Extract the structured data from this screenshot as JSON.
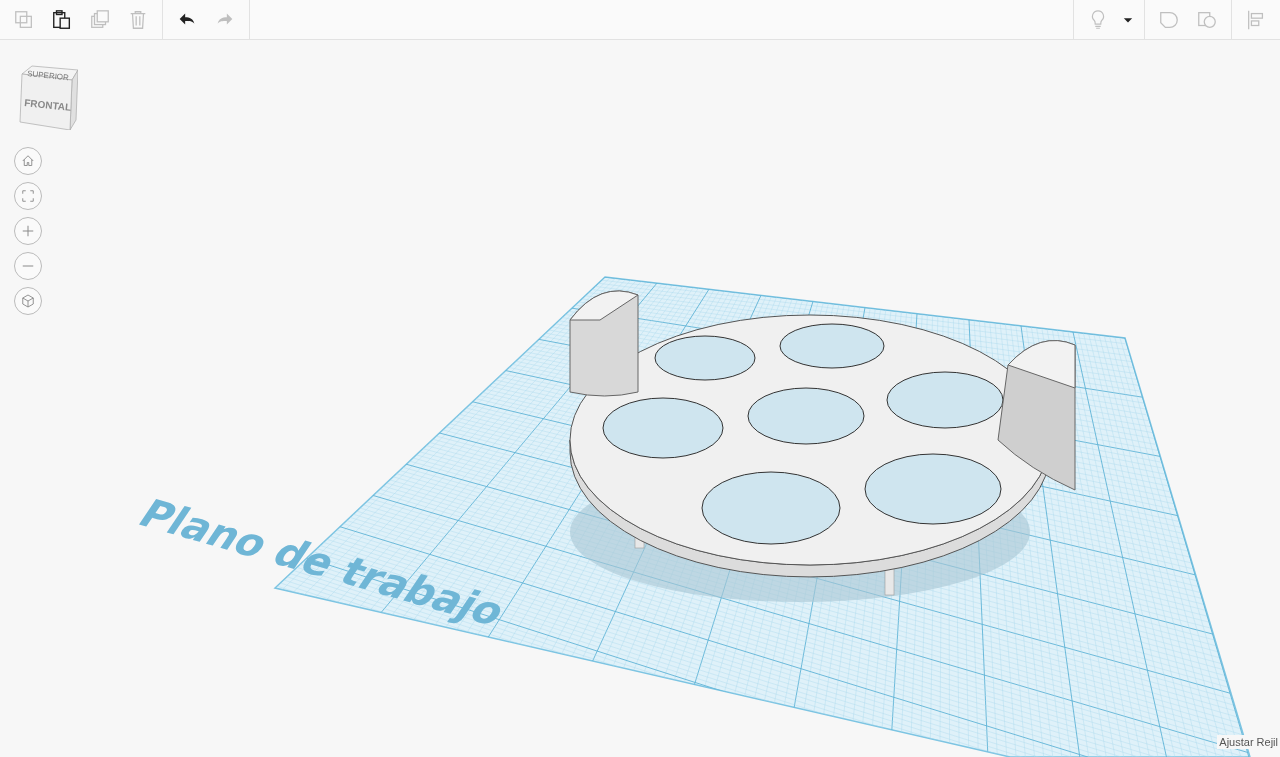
{
  "toolbar": {
    "edit_tools": [
      {
        "kind": "copy",
        "disabled": true
      },
      {
        "kind": "paste",
        "disabled": false
      },
      {
        "kind": "duplicate",
        "disabled": true
      },
      {
        "kind": "delete",
        "disabled": true
      }
    ],
    "history": [
      {
        "kind": "undo",
        "disabled": false
      },
      {
        "kind": "redo",
        "disabled": true
      }
    ],
    "right_tools": [
      {
        "kind": "light",
        "disabled": true
      },
      {
        "kind": "dropdown"
      },
      {
        "kind": "group",
        "disabled": true
      },
      {
        "kind": "ungroup",
        "disabled": true
      },
      {
        "kind": "align",
        "disabled": true
      }
    ]
  },
  "view_cube": {
    "top": "SUPERIOR",
    "front": "FRONTAL"
  },
  "nav_buttons": [
    {
      "kind": "home"
    },
    {
      "kind": "fit"
    },
    {
      "kind": "zoom_in"
    },
    {
      "kind": "zoom_out"
    },
    {
      "kind": "perspective"
    }
  ],
  "workplane": {
    "label": "Plano de trabajo"
  },
  "snap_grid": {
    "label": "Ajustar Rejil"
  }
}
